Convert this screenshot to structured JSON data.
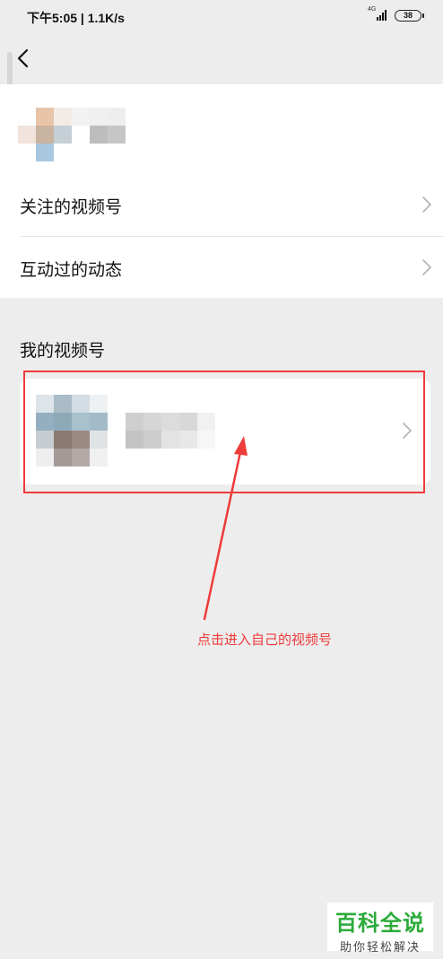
{
  "status_bar": {
    "time_speed": "下午5:05 | 1.1K/s",
    "network": "4G",
    "battery": "38"
  },
  "nav": {
    "back_icon": "chevron-left-icon"
  },
  "menu": {
    "items": [
      {
        "label": "关注的视频号",
        "icon": "chevron-right-icon"
      },
      {
        "label": "互动过的动态",
        "icon": "chevron-right-icon"
      }
    ]
  },
  "my_channel": {
    "section_title": "我的视频号",
    "icon": "chevron-right-icon"
  },
  "annotation": {
    "text": "点击进入自己的视频号",
    "color": "#ee3b3b"
  },
  "watermark": {
    "title": "百科全说",
    "subtitle": "助你轻松解决",
    "color": "#2cab3a"
  }
}
